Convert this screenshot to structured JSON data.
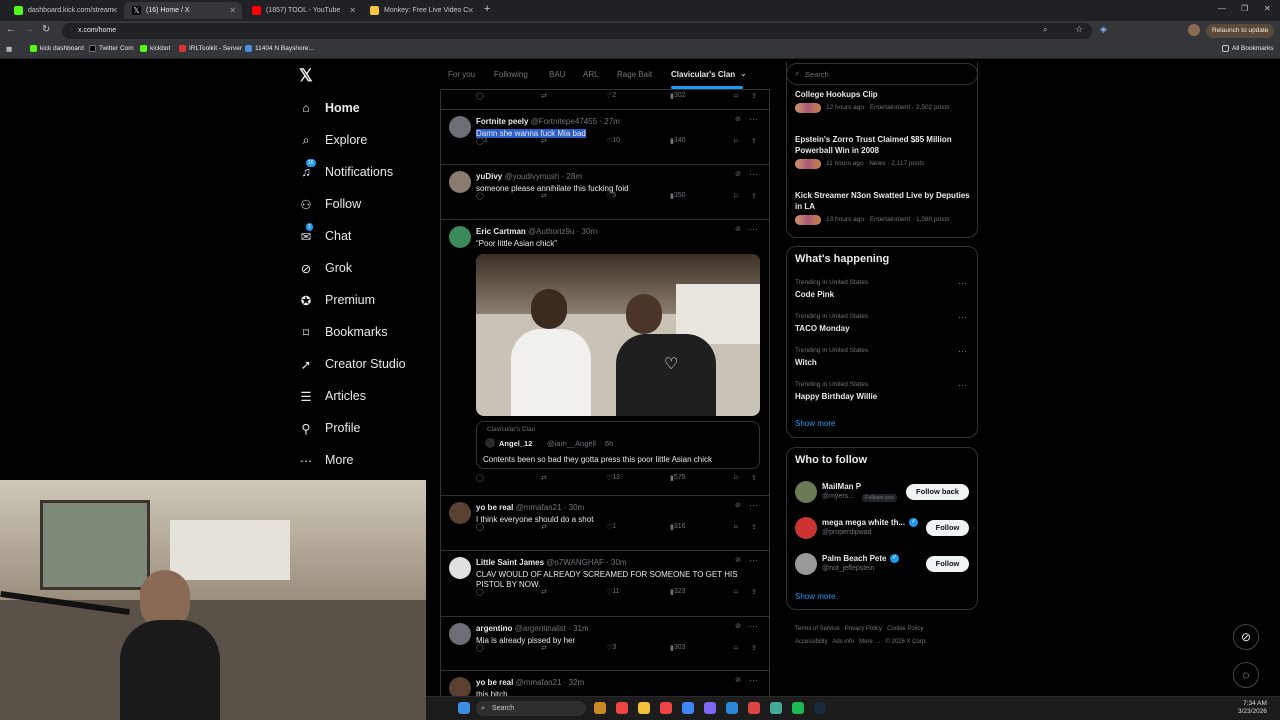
{
  "browser": {
    "tabs": [
      {
        "title": "dashboard.kick.com/stream",
        "color": "#53fc18"
      },
      {
        "title": "(16) Home / X",
        "color": "#ffffff"
      },
      {
        "title": "(1857) TOOL - YouTube",
        "color": "#ff0000"
      },
      {
        "title": "Monkey: Free Live Video C",
        "color": "#f5c542"
      }
    ],
    "url": "x.com/home",
    "relaunch": "Relaunch to update",
    "bookmarks": [
      "kick dashboard",
      "Twitter Com",
      "kickbot",
      "IRLToolkit - Server",
      "11404 N Bayshore..."
    ],
    "all_bookmarks": "All Bookmarks"
  },
  "sidebar": {
    "items": [
      {
        "label": "Home",
        "icon": "home-icon",
        "bold": true
      },
      {
        "label": "Explore",
        "icon": "search-icon"
      },
      {
        "label": "Notifications",
        "icon": "bell-icon",
        "badge": "16"
      },
      {
        "label": "Follow",
        "icon": "person-plus-icon"
      },
      {
        "label": "Chat",
        "icon": "mail-icon",
        "badge": "1"
      },
      {
        "label": "Grok",
        "icon": "grok-icon"
      },
      {
        "label": "Premium",
        "icon": "verified-icon"
      },
      {
        "label": "Bookmarks",
        "icon": "bookmark-icon"
      },
      {
        "label": "Creator Studio",
        "icon": "rocket-icon"
      },
      {
        "label": "Articles",
        "icon": "article-icon"
      },
      {
        "label": "Profile",
        "icon": "person-icon"
      },
      {
        "label": "More",
        "icon": "more-circle-icon"
      }
    ]
  },
  "feed": {
    "tabs": [
      "For you",
      "Following",
      "BAU",
      "ARL",
      "Rage Bait",
      "Clavicular's Clan"
    ],
    "active_tab": "Clavicular's Clan",
    "top_actions": {
      "likes": "2",
      "views": "302"
    },
    "tweets": [
      {
        "name": "Fortnite peely",
        "handle": "@Fortnitepe47455",
        "time": "27m",
        "text": "Damn she wanna fuck Mia bad",
        "replies": "1",
        "likes": "10",
        "views": "340"
      },
      {
        "name": "yuDivy",
        "handle": "@youdivymush",
        "time": "28m",
        "text": "someone please annihilate this fucking foid",
        "replies": "",
        "likes": "5",
        "views": "350"
      },
      {
        "name": "Eric Cartman",
        "handle": "@Authoriz9u",
        "time": "30m",
        "text": "“Poor little Asian chick”",
        "replies": "",
        "likes": "13",
        "views": "575",
        "quote": {
          "community": "Clavicular's Clan",
          "name": "Angel_12",
          "handle": "@iam__Angell",
          "time": "6h",
          "text": "Contents been so bad they gotta press this poor little Asian chick"
        }
      },
      {
        "name": "yo be real",
        "handle": "@mmafan21",
        "time": "30m",
        "text": "I think everyone should do a shot",
        "replies": "",
        "likes": "1",
        "views": "316"
      },
      {
        "name": "Little Saint James",
        "handle": "@o7WANGHAF",
        "time": "30m",
        "text": "CLAV WOULD OF ALREADY SCREAMED FOR SOMEONE TO GET HIS PISTOL BY NOW.",
        "replies": "",
        "likes": "11",
        "views": "323"
      },
      {
        "name": "argentino",
        "handle": "@argentinalist",
        "time": "31m",
        "text": "Mia is already pissed by her",
        "replies": "",
        "likes": "3",
        "views": "303"
      },
      {
        "name": "yo be real",
        "handle": "@mmafan21",
        "time": "32m",
        "text": "this bitch",
        "replies": "",
        "likes": "",
        "views": ""
      }
    ]
  },
  "right": {
    "search_placeholder": "Search",
    "news": [
      {
        "title": "College Hookups Clip",
        "meta": "12 hours ago · Entertainment · 2,502 posts"
      },
      {
        "title": "Epstein's Zorro Trust Claimed $85 Million Powerball Win in 2008",
        "meta": "11 hours ago · News · 2,117 posts"
      },
      {
        "title": "Kick Streamer N3on Swatted Live by Deputies in LA",
        "meta": "13 hours ago · Entertainment · 1,080 posts"
      }
    ],
    "happening_title": "What's happening",
    "trends": [
      {
        "sub": "Trending in United States",
        "title": "Code Pink"
      },
      {
        "sub": "Trending in United States",
        "title": "TACO Monday"
      },
      {
        "sub": "Trending in United States",
        "title": "Witch"
      },
      {
        "sub": "Trending in United States",
        "title": "Happy Birthday Willie"
      }
    ],
    "show_more": "Show more",
    "wtf_title": "Who to follow",
    "follows": [
      {
        "name": "MailMan P",
        "handle": "@myers...",
        "badge": "Follows you",
        "button": "Follow back"
      },
      {
        "name": "mega mega white th...",
        "handle": "@properdipwad",
        "button": "Follow"
      },
      {
        "name": "Palm Beach Pete",
        "handle": "@not_jeffepstein",
        "button": "Follow"
      }
    ],
    "footer": [
      "Terms of Service",
      "Privacy Policy",
      "Cookie Policy",
      "Accessibility",
      "Ads info",
      "More …",
      "© 2026 X Corp."
    ]
  },
  "taskbar": {
    "search": "Search",
    "time": "7:34 AM",
    "date": "3/23/2026"
  }
}
